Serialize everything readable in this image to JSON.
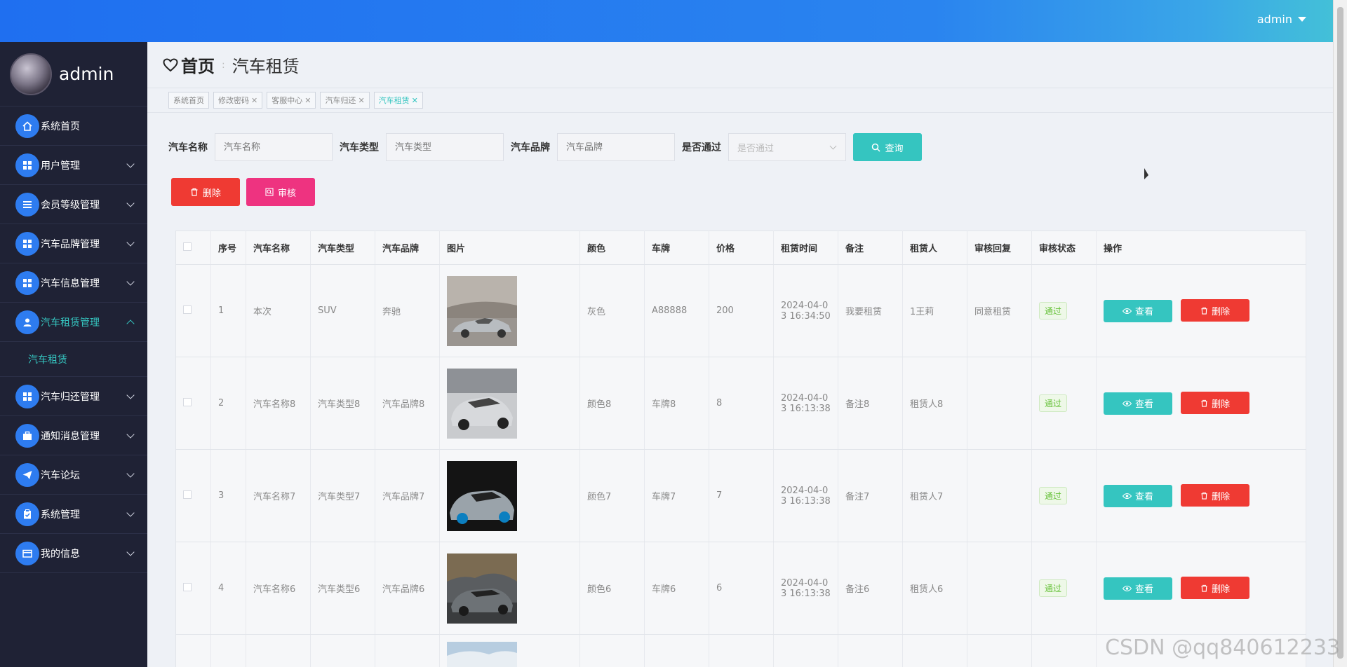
{
  "topbar": {
    "user": "admin"
  },
  "sidebar": {
    "profile_name": "admin",
    "items": [
      {
        "label": "系统首页",
        "icon": "home-icon"
      },
      {
        "label": "用户管理",
        "icon": "grid-icon"
      },
      {
        "label": "会员等级管理",
        "icon": "list-icon"
      },
      {
        "label": "汽车品牌管理",
        "icon": "grid-icon"
      },
      {
        "label": "汽车信息管理",
        "icon": "grid-icon"
      },
      {
        "label": "汽车租赁管理",
        "icon": "user-icon",
        "active": true
      },
      {
        "label": "汽车归还管理",
        "icon": "grid-icon"
      },
      {
        "label": "通知消息管理",
        "icon": "briefcase-icon"
      },
      {
        "label": "汽车论坛",
        "icon": "send-icon"
      },
      {
        "label": "系统管理",
        "icon": "clipboard-icon"
      },
      {
        "label": "我的信息",
        "icon": "wallet-icon"
      }
    ],
    "submenu": {
      "label": "汽车租赁"
    }
  },
  "breadcrumb": {
    "home": "首页",
    "current": "汽车租赁"
  },
  "tags": [
    {
      "label": "系统首页",
      "closable": false
    },
    {
      "label": "修改密码",
      "closable": true
    },
    {
      "label": "客服中心",
      "closable": true
    },
    {
      "label": "汽车归还",
      "closable": true
    },
    {
      "label": "汽车租赁",
      "closable": true,
      "active": true
    }
  ],
  "search": {
    "name_label": "汽车名称",
    "name_placeholder": "汽车名称",
    "type_label": "汽车类型",
    "type_placeholder": "汽车类型",
    "brand_label": "汽车品牌",
    "brand_placeholder": "汽车品牌",
    "pass_label": "是否通过",
    "pass_placeholder": "是否通过",
    "query_label": "查询"
  },
  "actions": {
    "delete_label": "删除",
    "audit_label": "审核"
  },
  "table": {
    "headers": [
      "序号",
      "汽车名称",
      "汽车类型",
      "汽车品牌",
      "图片",
      "颜色",
      "车牌",
      "价格",
      "租赁时间",
      "备注",
      "租赁人",
      "审核回复",
      "审核状态",
      "操作"
    ],
    "rows": [
      {
        "no": "1",
        "name": "本次",
        "type": "SUV",
        "brand": "奔驰",
        "color": "灰色",
        "plate": "A88888",
        "price": "200",
        "time1": "2024-04-0",
        "time2": "3 16:34:50",
        "remark": "我要租赁",
        "renter": "1王莉",
        "reply": "同意租赁",
        "status": "通过"
      },
      {
        "no": "2",
        "name": "汽车名称8",
        "type": "汽车类型8",
        "brand": "汽车品牌8",
        "color": "颜色8",
        "plate": "车牌8",
        "price": "8",
        "time1": "2024-04-0",
        "time2": "3 16:13:38",
        "remark": "备注8",
        "renter": "租赁人8",
        "reply": "",
        "status": "通过"
      },
      {
        "no": "3",
        "name": "汽车名称7",
        "type": "汽车类型7",
        "brand": "汽车品牌7",
        "color": "颜色7",
        "plate": "车牌7",
        "price": "7",
        "time1": "2024-04-0",
        "time2": "3 16:13:38",
        "remark": "备注7",
        "renter": "租赁人7",
        "reply": "",
        "status": "通过"
      },
      {
        "no": "4",
        "name": "汽车名称6",
        "type": "汽车类型6",
        "brand": "汽车品牌6",
        "color": "颜色6",
        "plate": "车牌6",
        "price": "6",
        "time1": "2024-04-0",
        "time2": "3 16:13:38",
        "remark": "备注6",
        "renter": "租赁人6",
        "reply": "",
        "status": "通过"
      }
    ],
    "view_label": "查看",
    "delete_label": "删除"
  },
  "watermark": "CSDN @qq840612233",
  "colors": {
    "accent": "#35c5c0",
    "danger": "#ef3a33",
    "audit": "#ee3380",
    "sidebar_bg": "#1f2235",
    "topbar": "#1f6ff0"
  }
}
